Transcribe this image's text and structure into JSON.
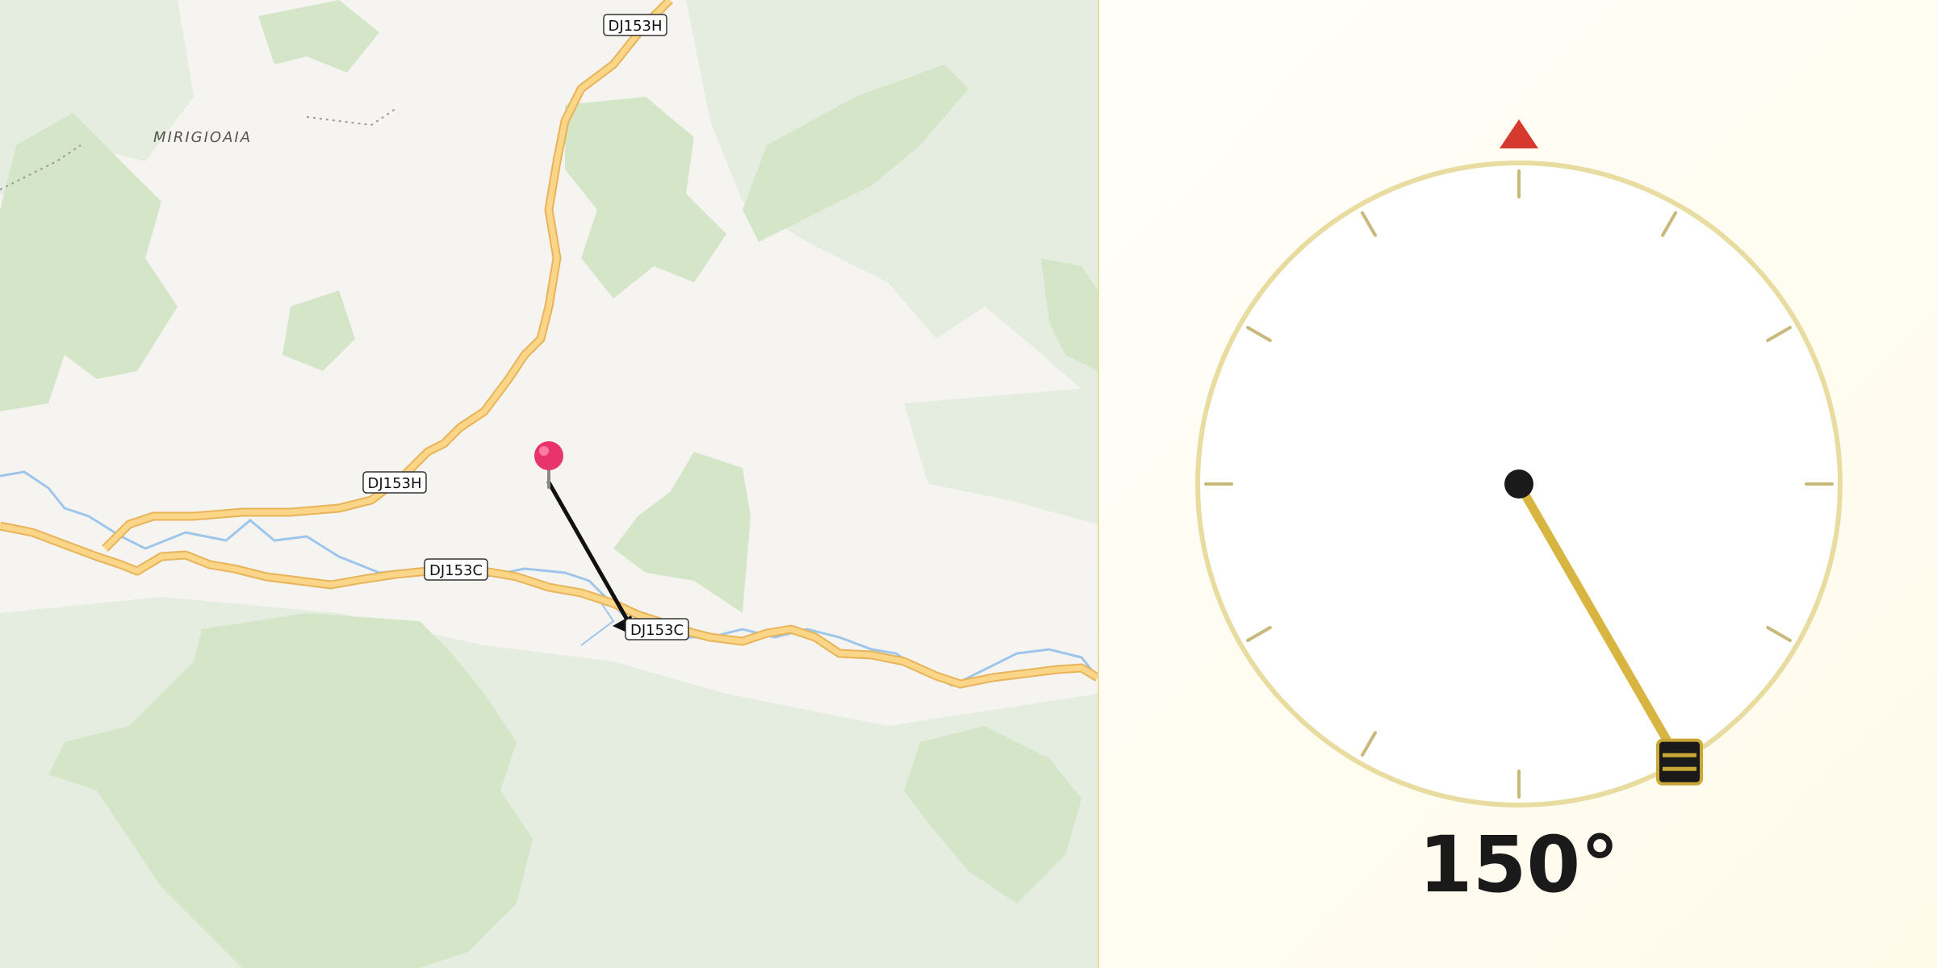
{
  "map": {
    "place_label": "MIRIGIOAIA",
    "road_labels": {
      "dj153h_top": "DJ153H",
      "dj153h_mid": "DJ153H",
      "dj153c_left": "DJ153C",
      "dj153c_right": "DJ153C"
    },
    "colors": {
      "land": "#f6f4f1",
      "forest": "#d4e6c7",
      "forest_light": "#e4ede0",
      "road_fill": "#fbd588",
      "road_casing": "#e8b45a",
      "river": "#9ec6ea",
      "pin": "#e8336f",
      "arrow": "#111111"
    },
    "markers": [
      "pin-marker",
      "direction-arrow"
    ]
  },
  "compass": {
    "heading_readout": "150°",
    "heading_degrees": 150,
    "colors": {
      "dial_face": "#ffffff",
      "dial_ring": "#e8dca0",
      "tick": "#c8b87a",
      "north_marker": "#d63a2f",
      "needle": "#d8b540",
      "hub": "#1a1a1a",
      "handle_fill": "#1a1a1a",
      "handle_border": "#c9a838"
    }
  }
}
